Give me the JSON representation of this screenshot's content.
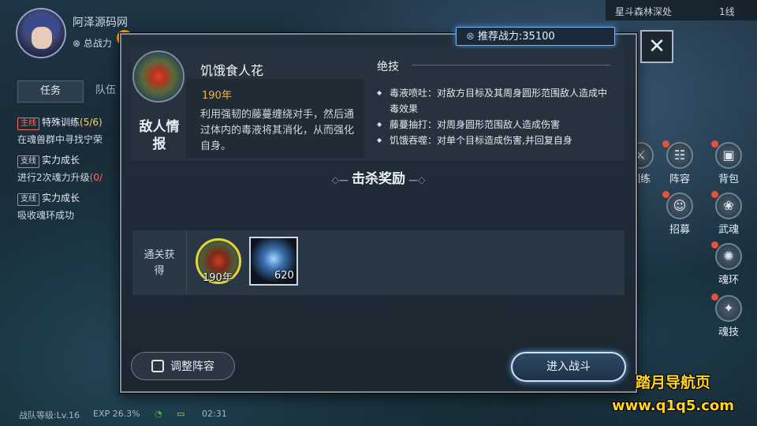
{
  "player": {
    "name": "阿泽源码网",
    "power_label": "总战力"
  },
  "tabs": {
    "task": "任务",
    "team": "队伍"
  },
  "quests": [
    {
      "tag": "主线",
      "title": "特殊训练",
      "progress": "(5/6)",
      "desc": "在魂兽群中寻找宁荣"
    },
    {
      "tag": "支线",
      "title": "实力成长",
      "progress": "",
      "desc": "进行2次魂力升级",
      "desc_progress": "(0/"
    },
    {
      "tag": "支线",
      "title": "实力成长",
      "progress": "",
      "desc": "吸收魂环成功"
    }
  ],
  "location": {
    "name": "星斗森林深处",
    "line": "1线"
  },
  "side_menu": [
    {
      "label": "训练",
      "icon": "training-icon"
    },
    {
      "label": "阵容",
      "icon": "formation-icon"
    },
    {
      "label": "背包",
      "icon": "bag-icon"
    },
    {
      "label": "招募",
      "icon": "recruit-icon"
    },
    {
      "label": "武魂",
      "icon": "martial-soul-icon"
    },
    {
      "label": "魂环",
      "icon": "soul-ring-icon"
    },
    {
      "label": "魂技",
      "icon": "soul-skill-icon"
    }
  ],
  "status_bar": {
    "team_level": "战队等级:Lv.16",
    "exp": "EXP 26.3%",
    "time": "02:31"
  },
  "dialog": {
    "recommend_power": "推荐战力:35100",
    "enemy_label": "敌人情报",
    "enemy_name": "饥饿食人花",
    "enemy_age": "190年",
    "enemy_desc": "利用强韧的藤蔓缠绕对手，然后通过体内的毒液将其消化，从而强化自身。",
    "skills_title": "绝技",
    "skills": [
      "毒液喷吐：对敌方目标及其周身圆形范围敌人造成中毒效果",
      "藤蔓抽打：对周身圆形范围敌人造成伤害",
      "饥饿吞噬：对单个目标造成伤害,并回复自身"
    ],
    "reward_title": "击杀奖励",
    "reward_label": "通关获得",
    "rewards": [
      {
        "name": "soul-ring",
        "count": "190年"
      },
      {
        "name": "soul-essence",
        "count": "620"
      }
    ],
    "adjust_button": "调整阵容",
    "battle_button": "进入战斗"
  },
  "watermark": {
    "line1": "踏月导航页",
    "line2": "www.q1q5.com"
  },
  "colors": {
    "accent": "#7fb1e6",
    "gold": "#e8b75a",
    "badge": "#f0a221",
    "main_quest": "#ff6d5e"
  }
}
